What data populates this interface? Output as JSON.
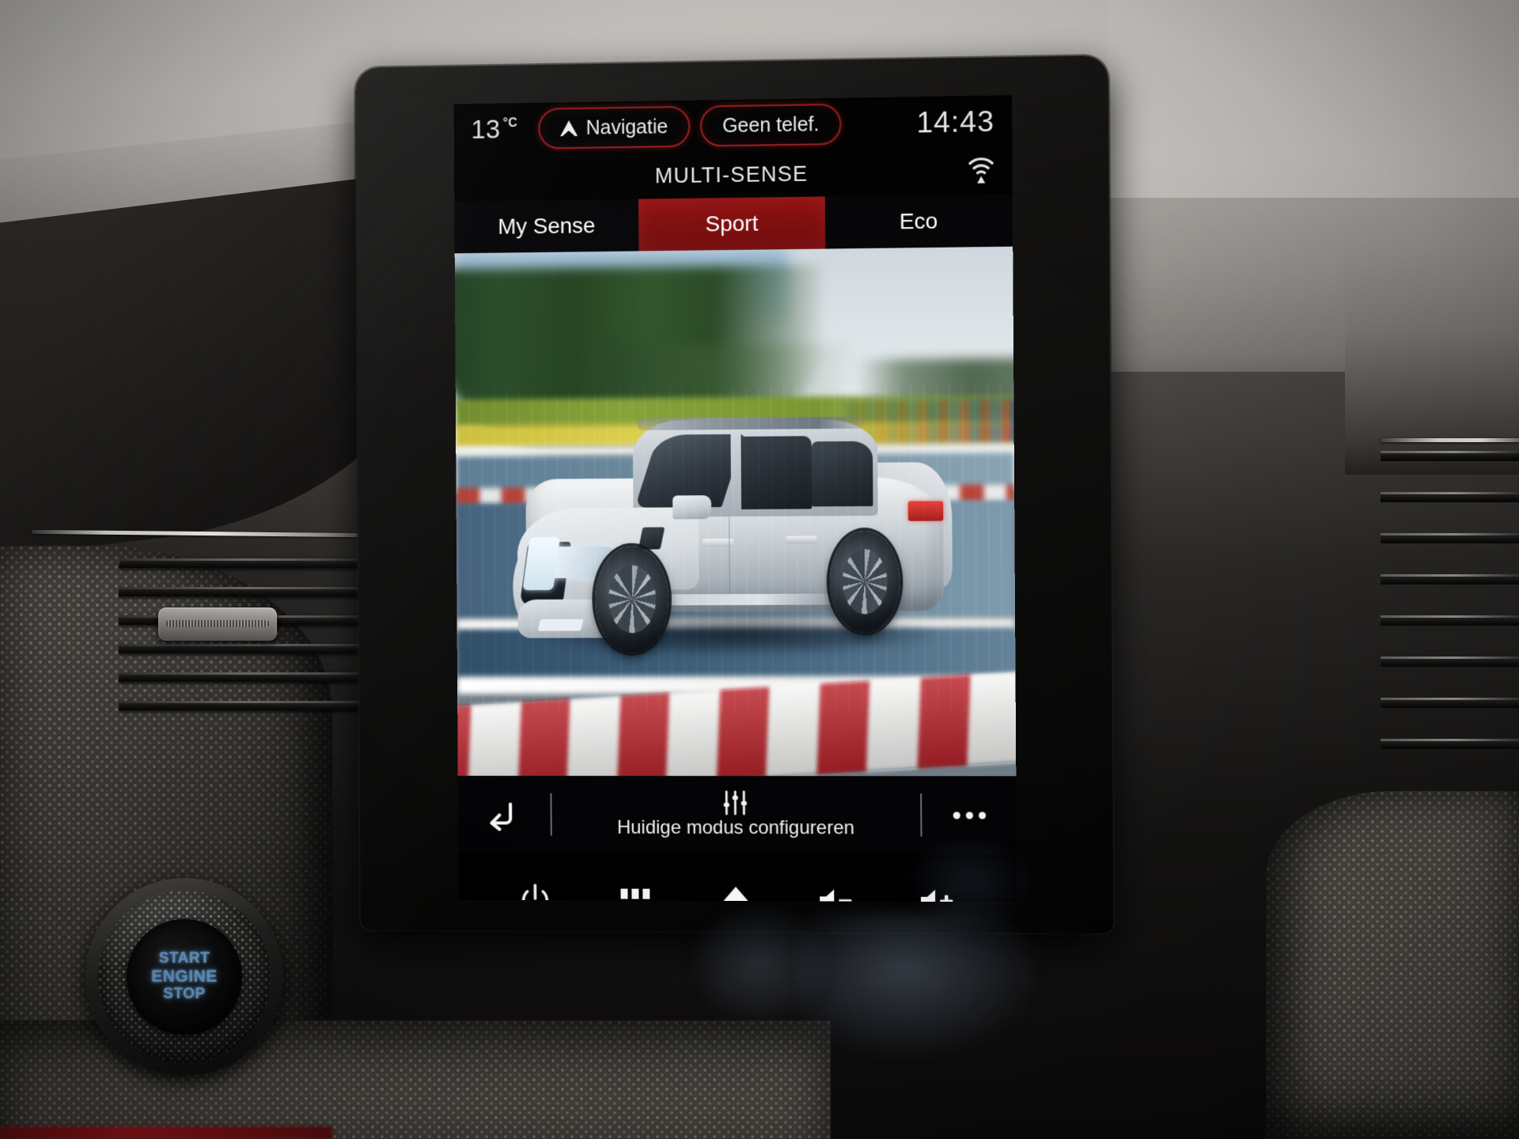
{
  "environment": {
    "start_engine_button": {
      "line1": "START",
      "line2": "ENGINE",
      "line3": "STOP"
    }
  },
  "screen": {
    "status_bar": {
      "temperature_value": "13",
      "temperature_unit": "°C",
      "navigation_pill": "Navigatie",
      "navigation_icon": "navigation-arrow-icon",
      "phone_pill": "Geen telef.",
      "clock": "14:43"
    },
    "title_bar": {
      "title": "MULTI-SENSE",
      "connectivity_icon": "wireless-signal-icon"
    },
    "tabs": [
      {
        "label": "My Sense",
        "active": false
      },
      {
        "label": "Sport",
        "active": true
      },
      {
        "label": "Eco",
        "active": false
      }
    ],
    "active_tab": "Sport",
    "hero": {
      "description": "Silver Renault Arkana coupe-SUV driving on a racetrack",
      "alt": "Sport mode illustration"
    },
    "action_bar": {
      "back_icon": "back-arrow-icon",
      "configure_icon": "sliders-icon",
      "configure_label": "Huidige modus configureren",
      "more_icon": "more-options-icon"
    },
    "nav_bar": [
      {
        "icon": "power-icon",
        "name": "power"
      },
      {
        "icon": "apps-grid-icon",
        "name": "apps"
      },
      {
        "icon": "home-icon",
        "name": "home"
      },
      {
        "icon": "volume-down-icon",
        "name": "volume-down"
      },
      {
        "icon": "volume-up-icon",
        "name": "volume-up"
      }
    ]
  },
  "colors": {
    "accent_red": "#8f1212",
    "pill_border": "#9e2022",
    "screen_bg": "#010101",
    "text_primary": "#f2f2f2",
    "engine_text": "#6fa8dd"
  }
}
